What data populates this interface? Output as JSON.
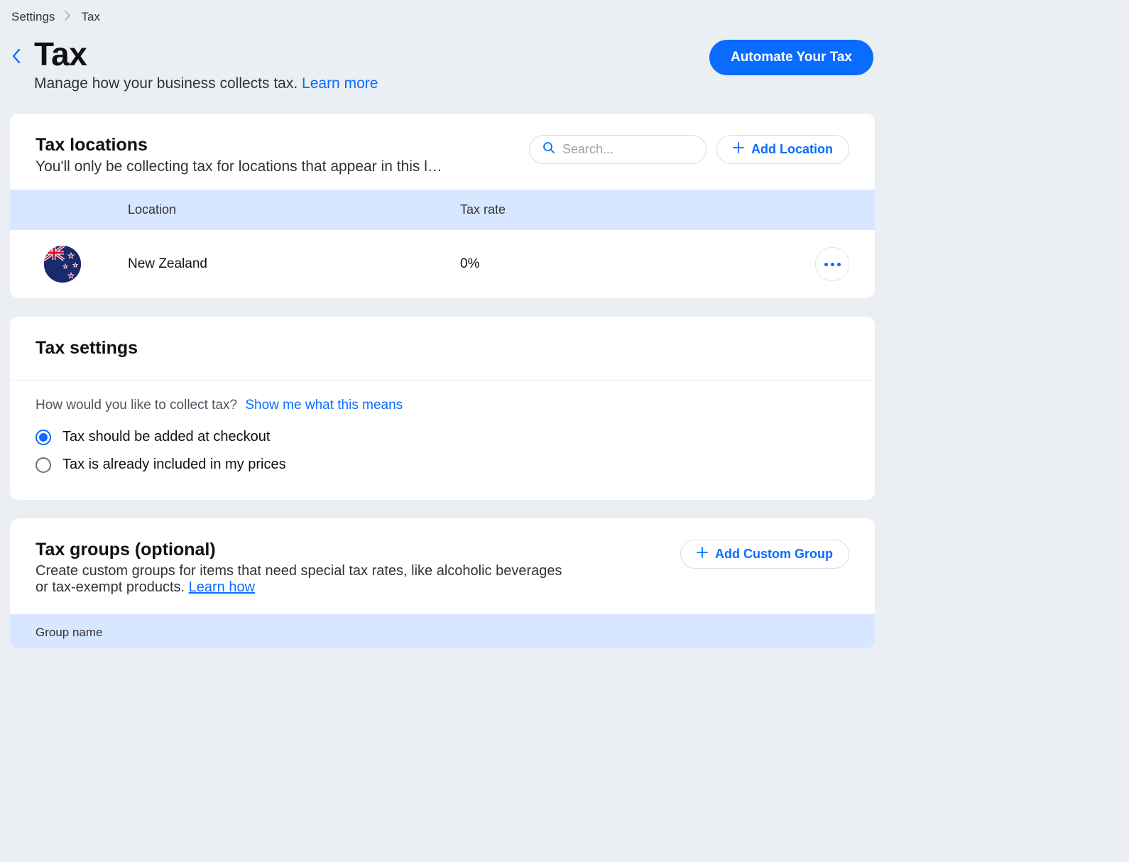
{
  "breadcrumb": {
    "item1": "Settings",
    "item2": "Tax"
  },
  "header": {
    "title": "Tax",
    "subtitle": "Manage how your business collects tax. ",
    "learn_more": "Learn more",
    "primary_button": "Automate Your Tax"
  },
  "locations": {
    "title": "Tax locations",
    "subtitle": "You'll only be collecting tax for locations that appear in this l…",
    "search_placeholder": "Search...",
    "add_button": "Add Location",
    "columns": {
      "location": "Location",
      "rate": "Tax rate"
    },
    "rows": [
      {
        "name": "New Zealand",
        "rate": "0%",
        "flag": "nz"
      }
    ]
  },
  "settings": {
    "title": "Tax settings",
    "question": "How would you like to collect tax?",
    "help_link": "Show me what this means",
    "options": [
      {
        "label": "Tax should be added at checkout",
        "selected": true
      },
      {
        "label": "Tax is already included in my prices",
        "selected": false
      }
    ]
  },
  "groups": {
    "title": "Tax groups (optional)",
    "subtitle": "Create custom groups for items that need special tax rates, like alcoholic beverages or tax-exempt products. ",
    "learn_how": "Learn how",
    "add_button": "Add Custom Group",
    "column": "Group name"
  }
}
